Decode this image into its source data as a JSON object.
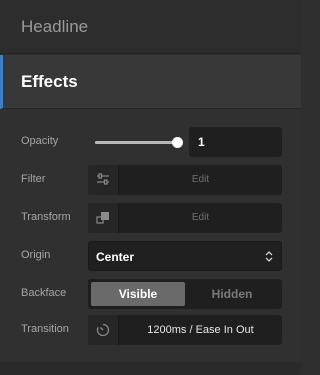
{
  "sections": {
    "headline": {
      "title": "Headline"
    },
    "effects": {
      "title": "Effects"
    }
  },
  "opacity": {
    "label": "Opacity",
    "value": "1",
    "slider_level": 1.0
  },
  "filter": {
    "label": "Filter",
    "action": "Edit",
    "icon": "sliders-icon"
  },
  "transform": {
    "label": "Transform",
    "action": "Edit",
    "icon": "transform-icon"
  },
  "origin": {
    "label": "Origin",
    "value": "Center"
  },
  "backface": {
    "label": "Backface",
    "options": [
      "Visible",
      "Hidden"
    ],
    "selected": "Visible"
  },
  "transition": {
    "label": "Transition",
    "value": "1200ms / Ease In Out",
    "icon": "timer-icon"
  },
  "colors": {
    "accent": "#3f7fc6",
    "panel": "#303030",
    "field": "#1f1f1f"
  }
}
